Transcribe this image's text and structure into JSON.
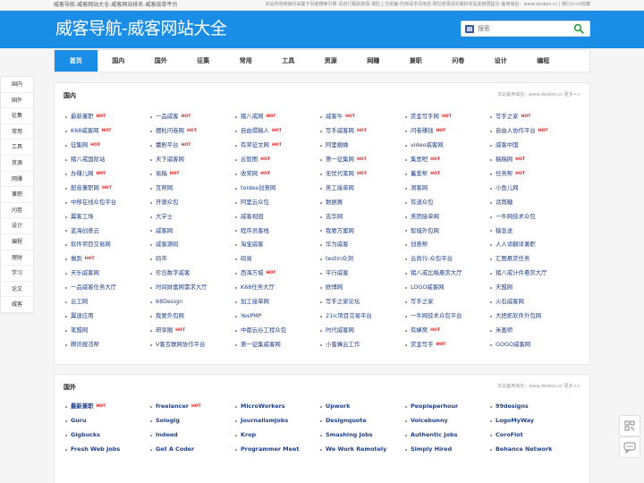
{
  "topbar": {
    "left": "威客导航-威客网站大全-威客网站排名-威客接单平台",
    "right": "本站所有链接均采集于百度搜索引擎-请自行甄别真假-谨防上当受骗-仿用请求清用途-网址收录请先做好本站友链再提交-备用域名：www.deskos.cc | 按Ctrl+D收藏"
  },
  "logo": "威客导航-威客网站大全",
  "search": {
    "placeholder": "搜索"
  },
  "nav": [
    "首页",
    "国内",
    "国外",
    "征集",
    "常用",
    "工具",
    "资源",
    "网赚",
    "兼职",
    "问卷",
    "设计",
    "编程"
  ],
  "side": [
    "国内",
    "国外",
    "征集",
    "常用",
    "工具",
    "资源",
    "网赚",
    "兼职",
    "问卷",
    "设计",
    "编程",
    "理财",
    "学习",
    "论文",
    "威客"
  ],
  "panels": [
    {
      "title": "国内",
      "more": "本站备用域名：www.deskos.cc 更多>>",
      "hot_label": "HOT",
      "items": [
        {
          "t": "最新兼职",
          "hot": true
        },
        {
          "t": "一品威客",
          "hot": true
        },
        {
          "t": "猪八戒网",
          "hot": true
        },
        {
          "t": "威客牛",
          "hot": true
        },
        {
          "t": "赏金写手网",
          "hot": true
        },
        {
          "t": "写手之家",
          "hot": true
        },
        {
          "t": "K68威客网",
          "hot": true
        },
        {
          "t": "摆粒问卷网",
          "hot": true
        },
        {
          "t": "自由撰稿人",
          "hot": true
        },
        {
          "t": "写手威客网",
          "hot": true
        },
        {
          "t": "问卷赚钱",
          "hot": true
        },
        {
          "t": "自由人协作平台",
          "hot": true
        },
        {
          "t": "征集网",
          "hot": true
        },
        {
          "t": "蕾剧平台",
          "hot": true
        },
        {
          "t": "有奖征文网",
          "hot": true
        },
        {
          "t": "阿里蜘蛛",
          "hot": false
        },
        {
          "t": "video威客网",
          "hot": false
        },
        {
          "t": "威客中国",
          "hot": false
        },
        {
          "t": "猪八戒国际站",
          "hot": false
        },
        {
          "t": "天下威客网",
          "hot": false
        },
        {
          "t": "云智图",
          "hot": true
        },
        {
          "t": "第一征集网",
          "hot": true
        },
        {
          "t": "集思吧",
          "hot": true
        },
        {
          "t": "稿稿网",
          "hot": true
        },
        {
          "t": "办赚儿网",
          "hot": true
        },
        {
          "t": "易稿",
          "hot": true
        },
        {
          "t": "收奖网",
          "hot": true
        },
        {
          "t": "无忧代笔网",
          "hot": true
        },
        {
          "t": "蓄爱帮",
          "hot": true
        },
        {
          "t": "任务帮",
          "hot": true
        },
        {
          "t": "配音兼职网",
          "hot": true
        },
        {
          "t": "互帮网",
          "hot": false
        },
        {
          "t": "toidea创意网",
          "hot": false
        },
        {
          "t": "美工接单网",
          "hot": false
        },
        {
          "t": "测客网",
          "hot": false
        },
        {
          "t": "小鱼儿网",
          "hot": false
        },
        {
          "t": "中移在线众包平台",
          "hot": false
        },
        {
          "t": "开源众包",
          "hot": false
        },
        {
          "t": "阿里云众包",
          "hot": false
        },
        {
          "t": "数据赛",
          "hot": false
        },
        {
          "t": "有道众包",
          "hot": false
        },
        {
          "t": "话筒糖",
          "hot": false
        },
        {
          "t": "翼客工场",
          "hot": false
        },
        {
          "t": "大学士",
          "hot": false
        },
        {
          "t": "威客视园",
          "hot": false
        },
        {
          "t": "志华网",
          "hot": false
        },
        {
          "t": "美团接单网",
          "hot": false
        },
        {
          "t": "一牛网技术众包",
          "hot": false
        },
        {
          "t": "蓝海创意云",
          "hot": false
        },
        {
          "t": "威客网",
          "hot": false
        },
        {
          "t": "程序员客栈",
          "hot": false
        },
        {
          "t": "我要方案网",
          "hot": false
        },
        {
          "t": "智城外包网",
          "hot": false
        },
        {
          "t": "猿急送",
          "hot": false
        },
        {
          "t": "软件项目交易网",
          "hot": false
        },
        {
          "t": "威客源码",
          "hot": false
        },
        {
          "t": "淘宝威客",
          "hot": false
        },
        {
          "t": "华为威客",
          "hot": false
        },
        {
          "t": "创意帮",
          "hot": false
        },
        {
          "t": "人人译翻译兼职",
          "hot": false
        },
        {
          "t": "做到",
          "hot": true
        },
        {
          "t": "码市",
          "hot": false
        },
        {
          "t": "码易",
          "hot": false
        },
        {
          "t": "testin众测",
          "hot": false
        },
        {
          "t": "云尚行-众包平台",
          "hot": false
        },
        {
          "t": "汇图悬赏任务",
          "hot": false
        },
        {
          "t": "天乐威客网",
          "hot": false
        },
        {
          "t": "珍岛数字威客",
          "hot": false
        },
        {
          "t": "西海方城",
          "hot": true
        },
        {
          "t": "平行威客",
          "hot": false
        },
        {
          "t": "猪八戒比稿悬赏大厅",
          "hot": false
        },
        {
          "t": "猪八戒计件悬赏大厅",
          "hot": false
        },
        {
          "t": "一品威客任务大厅",
          "hot": false
        },
        {
          "t": "时间财富网需求大厅",
          "hot": false
        },
        {
          "t": "K68任务大厅",
          "hot": false
        },
        {
          "t": "欧博网",
          "hot": false
        },
        {
          "t": "LOGO威客网",
          "hot": false
        },
        {
          "t": "天盟网",
          "hot": false
        },
        {
          "t": "云工网",
          "hot": false
        },
        {
          "t": "68Design",
          "hot": false
        },
        {
          "t": "加工接单网",
          "hot": false
        },
        {
          "t": "写手之家论坛",
          "hot": false
        },
        {
          "t": "写手之家",
          "hot": false
        },
        {
          "t": "火石威客网",
          "hot": false
        },
        {
          "t": "翼速应用",
          "hot": false
        },
        {
          "t": "我要外包网",
          "hot": false
        },
        {
          "t": "YesPMP",
          "hot": false
        },
        {
          "t": "21ic项目交易平台",
          "hot": false
        },
        {
          "t": "一牛网技术众包平台",
          "hot": false
        },
        {
          "t": "大把抓软件外包网",
          "hot": false
        },
        {
          "t": "笔盟网",
          "hot": false
        },
        {
          "t": "研享圈",
          "hot": true
        },
        {
          "t": "中都云谷工程众包",
          "hot": false
        },
        {
          "t": "时代威客网",
          "hot": false
        },
        {
          "t": "有蜂窝",
          "hot": true
        },
        {
          "t": "米画师",
          "hot": false
        },
        {
          "t": "腾讯搜活帮",
          "hot": false
        },
        {
          "t": "V客互联网协作平台",
          "hot": false
        },
        {
          "t": "第一征集威客网",
          "hot": false
        },
        {
          "t": "小蜜蜂云工作",
          "hot": false
        },
        {
          "t": "赏金写手",
          "hot": true
        },
        {
          "t": "GOGO威客网",
          "hot": false
        }
      ]
    },
    {
      "title": "国外",
      "more": "本站备用域名：www.deskos.cc 更多>>",
      "hot_label": "HOT",
      "items": [
        {
          "t": "最新兼职",
          "hot": true
        },
        {
          "t": "freelancer",
          "hot": true
        },
        {
          "t": "MicroWorkers",
          "hot": false
        },
        {
          "t": "Upwork",
          "hot": false
        },
        {
          "t": "Peopleperhour",
          "hot": false
        },
        {
          "t": "99designs",
          "hot": false
        },
        {
          "t": "Guru",
          "hot": false
        },
        {
          "t": "Sologig",
          "hot": false
        },
        {
          "t": "Journalismjobs",
          "hot": false
        },
        {
          "t": "Designquote",
          "hot": false
        },
        {
          "t": "Voicebunny",
          "hot": false
        },
        {
          "t": "LogoMyWay",
          "hot": false
        },
        {
          "t": "Gigbucks",
          "hot": false
        },
        {
          "t": "Indeed",
          "hot": false
        },
        {
          "t": "Krop",
          "hot": false
        },
        {
          "t": "Smashing Jobs",
          "hot": false
        },
        {
          "t": "Authentic Jobs",
          "hot": false
        },
        {
          "t": "CoroFlot",
          "hot": false
        },
        {
          "t": "Fresh Web Jobs",
          "hot": false
        },
        {
          "t": "Get A Coder",
          "hot": false
        },
        {
          "t": "Programmer Meet",
          "hot": false
        },
        {
          "t": "We Work Remotely",
          "hot": false
        },
        {
          "t": "Simply Hired",
          "hot": false
        },
        {
          "t": "Behance Network",
          "hot": false
        }
      ]
    }
  ],
  "colors": {
    "brand": "#1a8ee6",
    "link": "#1f3f87",
    "hot": "#e02020"
  },
  "icons": {
    "search": "search-icon",
    "go": "magnifier-icon",
    "qr": "qrcode-icon",
    "chat": "chat-icon"
  }
}
